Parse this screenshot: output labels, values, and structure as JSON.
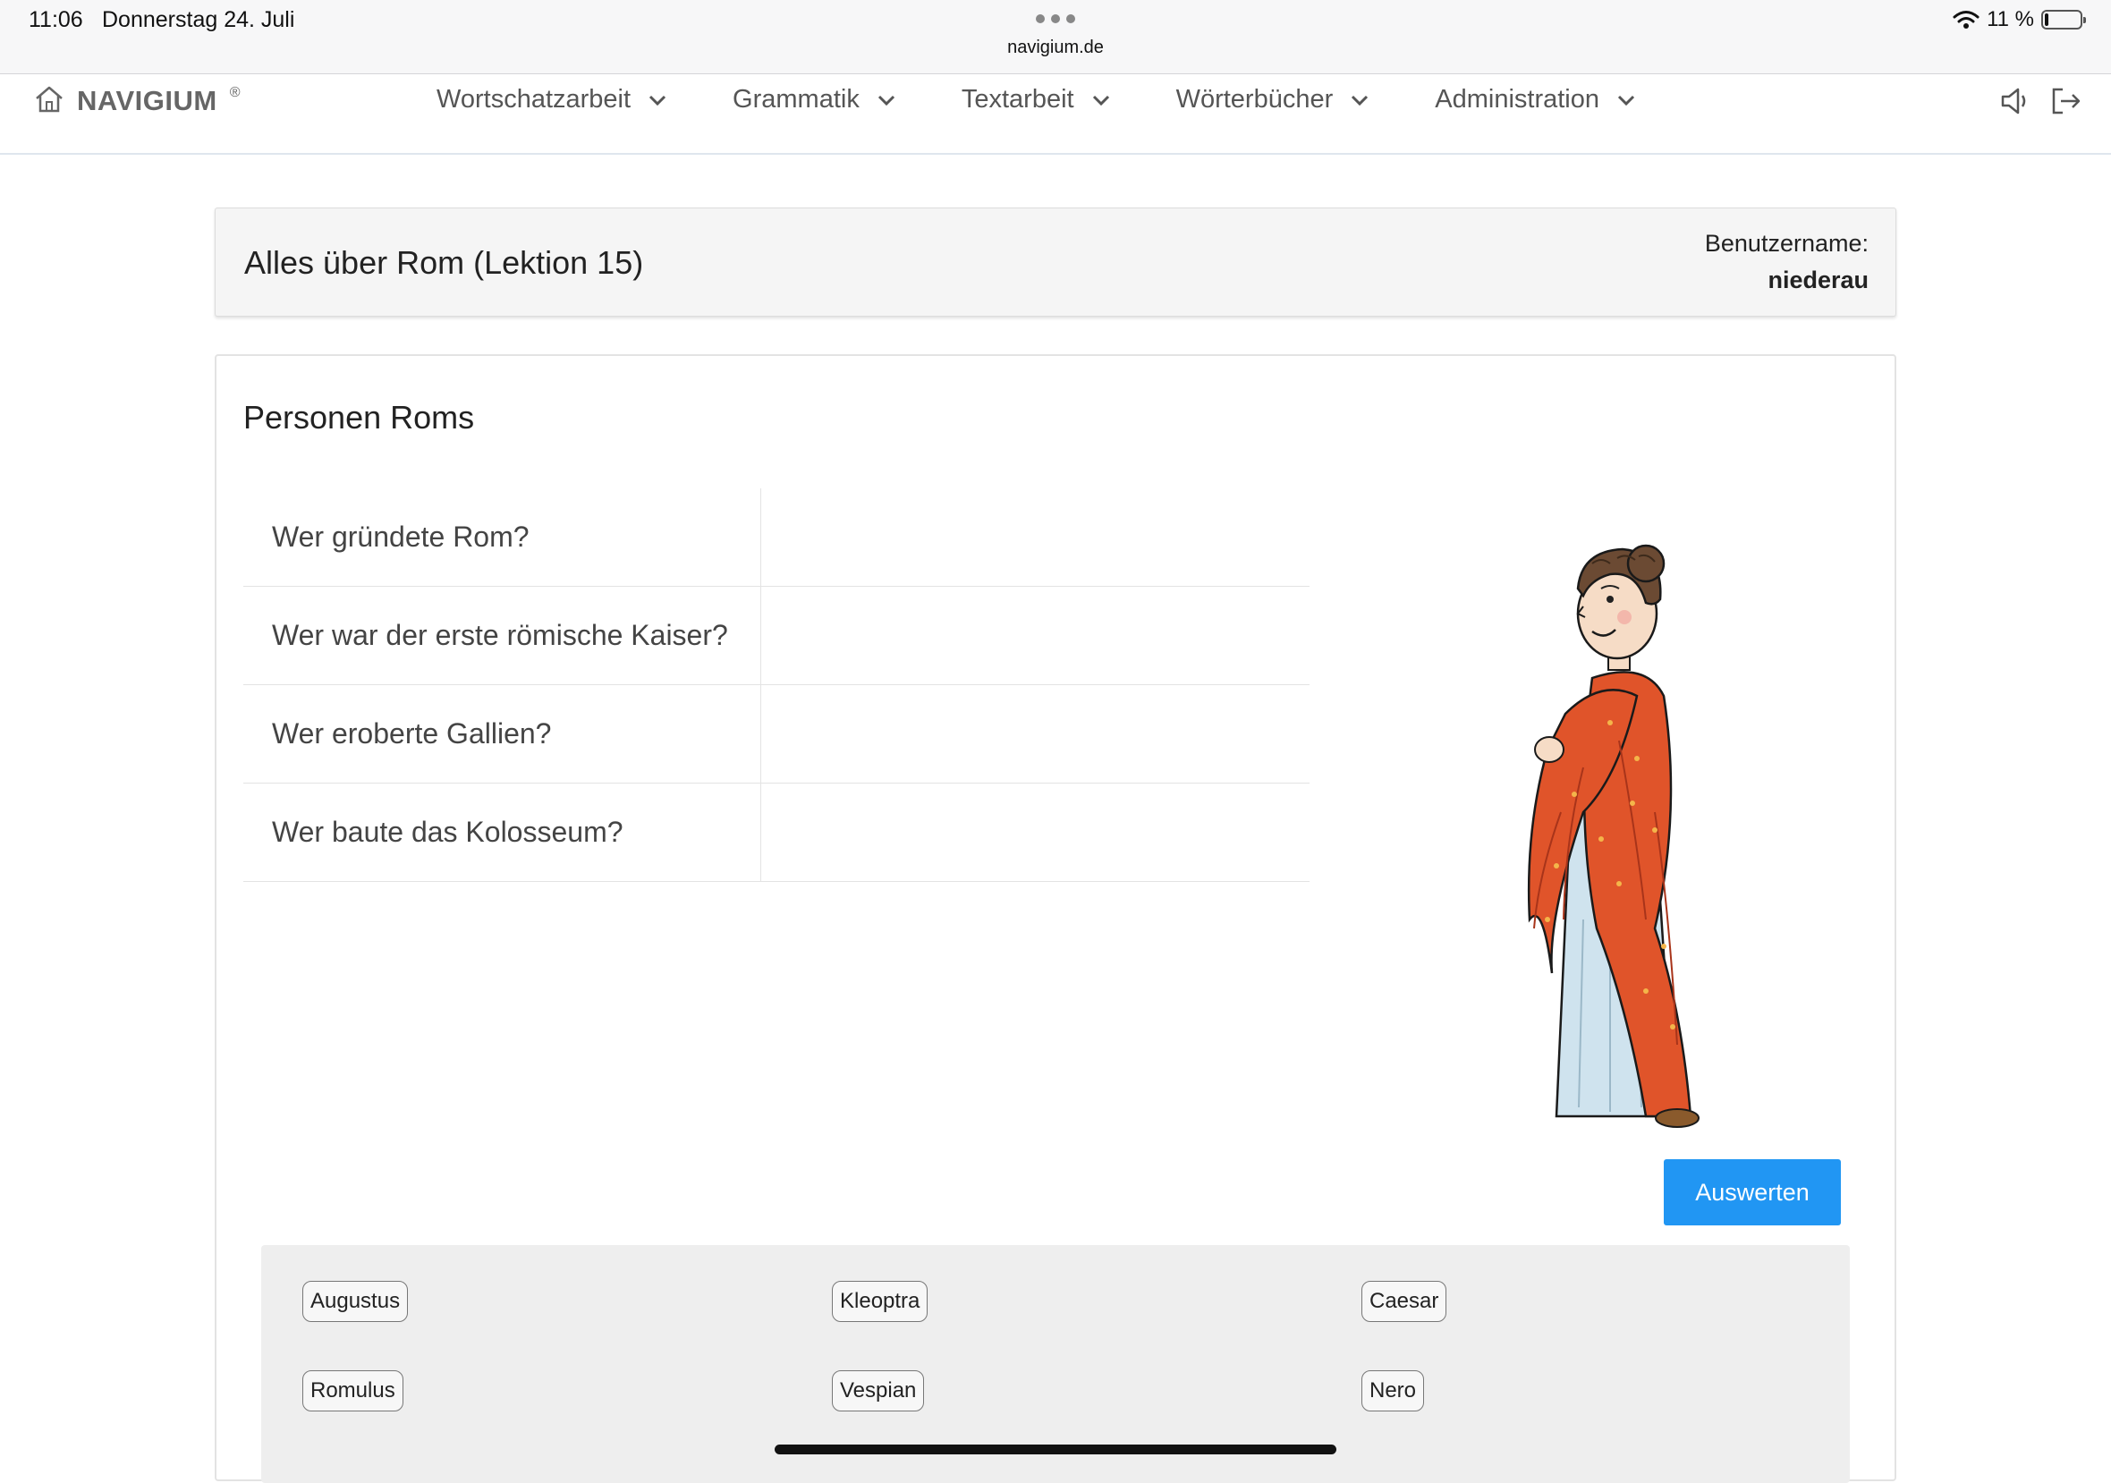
{
  "status_bar": {
    "time": "11:06",
    "date": "Donnerstag 24. Juli",
    "url": "navigium.de",
    "battery": "11 %",
    "battery_level": 0.11
  },
  "navbar": {
    "brand": "NAVIGIUM",
    "brand_mark": "®",
    "menu": [
      {
        "label": "Wortschatzarbeit",
        "icon": "chevron-down-icon"
      },
      {
        "label": "Grammatik",
        "icon": "chevron-down-icon"
      },
      {
        "label": "Textarbeit",
        "icon": "chevron-down-icon"
      },
      {
        "label": "Wörterbücher",
        "icon": "chevron-down-icon"
      },
      {
        "label": "Administration",
        "icon": "chevron-down-icon"
      }
    ],
    "right_icons": [
      "speaker-icon",
      "logout-icon"
    ]
  },
  "header": {
    "title": "Alles über Rom (Lektion 15)",
    "user_label": "Benutzername:",
    "username": "niederau"
  },
  "exercise": {
    "title": "Personen Roms",
    "questions": [
      {
        "question": "Wer gründete Rom?",
        "answer": ""
      },
      {
        "question": "Wer war der erste römische Kaiser?",
        "answer": ""
      },
      {
        "question": "Wer eroberte Gallien?",
        "answer": ""
      },
      {
        "question": "Wer baute das Kolosseum?",
        "answer": ""
      }
    ],
    "evaluate_button": "Auswerten",
    "word_bank": [
      "Augustus",
      "Kleoptra",
      "Caesar",
      "Romulus",
      "Vespian",
      "Nero"
    ]
  },
  "colors": {
    "accent": "#2196f3",
    "toga": "#e0542a",
    "tunic": "#cfe3ee"
  }
}
